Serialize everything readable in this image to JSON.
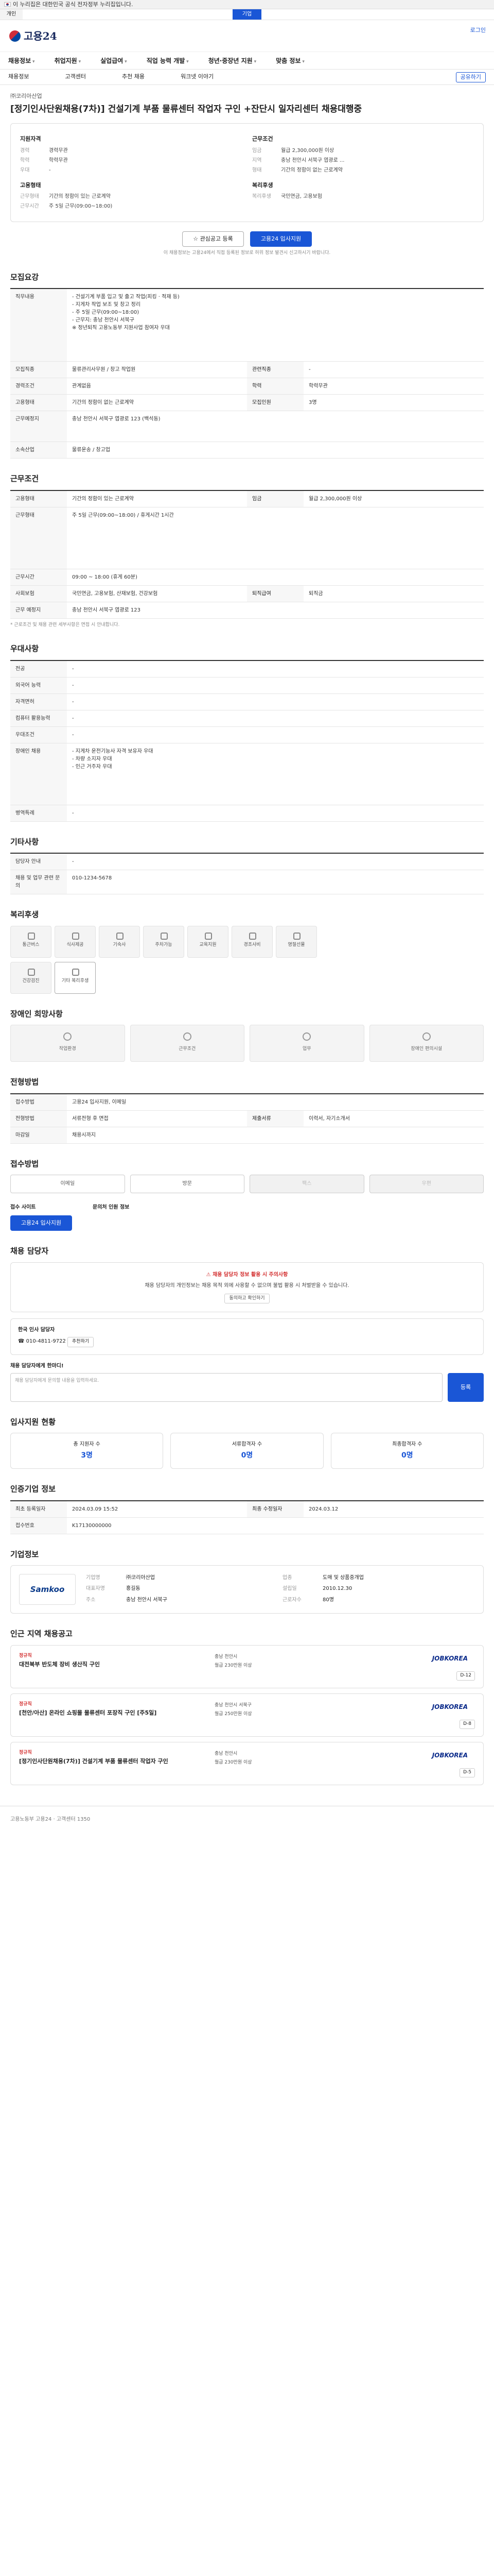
{
  "gov_banner": "이 누리집은 대한민국 공식 전자정부 누리집입니다.",
  "topline": {
    "left": "개인",
    "center": "기업"
  },
  "brand": {
    "logo": "고용24",
    "login": "로그인"
  },
  "menu": [
    "채용정보",
    "취업지원",
    "실업급여",
    "직업 능력 개발",
    "청년·중장년 지원",
    "맞춤 정보"
  ],
  "subnav": [
    "채용정보",
    "고객센터",
    "추천 채용",
    "워크넷 이야기"
  ],
  "share": "공유하기",
  "hero": {
    "agency": "㈜코리아산업",
    "title": "[정기인사단원채용(7차)] 건설기계 부품 물류센터 작업자 구인 +잔단시 일자리센터 채용대행중"
  },
  "info": {
    "col1_title": "지원자격",
    "col1": [
      [
        "경력",
        "경력무관"
      ],
      [
        "학력",
        "학력무관"
      ],
      [
        "우대",
        "-"
      ]
    ],
    "col2_title": "근무조건",
    "col2": [
      [
        "임금",
        "월급 2,300,000원 이상"
      ],
      [
        "지역",
        "충남 천안시 서북구 엽광로 ..."
      ],
      [
        "형태",
        "기간의 정함이 없는 근로계약"
      ]
    ],
    "col3_title": "고용형태",
    "col3": [
      [
        "근무형태",
        "기간의 정함이 있는 근로계약"
      ],
      [
        "근무시간",
        "주 5일 근무(09:00~18:00)"
      ]
    ],
    "col4_title": "복리후생",
    "col4": [
      [
        "복리후생",
        "국민연금, 고용보험"
      ]
    ]
  },
  "buttons": {
    "interest": "관심공고 등록",
    "apply": "고용24 입사지원"
  },
  "notice": "이 채용정보는 고용24에서 직접 등록된 정보로 허위 정보 발견시 신고하시기 바랍니다.",
  "s1": {
    "title": "모집요강",
    "duty_label": "직무내용",
    "duty_text": "- 건설기계 부품 입고 및 출고 작업(피킹 · 적재 등)\n- 지게차 작업 보조 및 창고 정리\n- 주 5일 근무(09:00~18:00)\n- 근무지: 충남 천안시 서북구\n※ 정년퇴직 고용노동부 지원사업 참여자 우대",
    "rows": [
      [
        "모집직종",
        "물류관리사무원 / 창고 작업원"
      ],
      [
        "관련직종",
        "-"
      ],
      [
        "경력조건",
        "관계없음"
      ],
      [
        "학력",
        "학력무관"
      ],
      [
        "고용형태",
        "기간의 정함이 없는 근로계약"
      ],
      [
        "모집인원",
        "3명"
      ],
      [
        "근무예정지",
        "충남 천안시 서북구 엽광로 123 (백석동)"
      ],
      [
        "소속산업",
        "물류운송 / 창고업"
      ]
    ]
  },
  "s2": {
    "title": "근무조건",
    "rows": [
      [
        "고용형태",
        "기간의 정함이 있는 근로계약"
      ],
      [
        "임금",
        "월급 2,300,000원 이상"
      ],
      [
        "근무형태",
        "주 5일 근무"
      ],
      [
        "근무시간",
        "09:00 ~ 18:00 (휴게 60분)"
      ],
      [
        "사회보험",
        "국민연금, 고용보험, 산재보험, 건강보험"
      ],
      [
        "퇴직급여",
        "퇴직금"
      ],
      [
        "근무 예정지",
        "충남 천안시 서북구 엽광로 123"
      ]
    ],
    "worktime_note": "주 5일 근무(09:00~18:00) / 휴게시간 1시간",
    "note": "* 근로조건 및 채용 관련 세부사항은 면접 시 안내합니다."
  },
  "s3": {
    "title": "우대사항",
    "rows": [
      [
        "전공",
        "-"
      ],
      [
        "외국어 능력",
        "-"
      ],
      [
        "자격면허",
        "-"
      ],
      [
        "컴퓨터 활용능력",
        "-"
      ],
      [
        "우대조건",
        "-"
      ],
      [
        "장애인 채용",
        "-"
      ],
      [
        "병역특례",
        "-"
      ]
    ],
    "etc": "- 지게차 운전기능사 자격 보유자 우대\n- 차량 소지자 우대\n- 인근 거주자 우대"
  },
  "s4": {
    "title": "기타사항",
    "rows": [
      [
        "담당자 안내",
        "-"
      ],
      [
        "채용 및 업무 관련 문의",
        "010-1234-5678"
      ]
    ]
  },
  "s5": {
    "title": "복리후생",
    "icons": [
      "통근버스",
      "식사제공",
      "기숙사",
      "주차가능",
      "교육지원",
      "경조사비",
      "명절선물",
      "건강검진"
    ],
    "extra": "기타 복리후생"
  },
  "s6": {
    "title": "장애인 희망사항",
    "cards": [
      "작업환경",
      "근무조건",
      "업무",
      "장애인 편의시설"
    ]
  },
  "s7": {
    "title": "전형방법",
    "rows": [
      [
        "접수방법",
        "고용24 입사지원, 이메일"
      ],
      [
        "전형방법",
        "서류전형 후 면접"
      ],
      [
        "제출서류",
        "이력서, 자기소개서"
      ],
      [
        "마감일",
        "채용시까지"
      ]
    ]
  },
  "s8": {
    "title": "접수방법",
    "tabs": [
      "이메일",
      "방문",
      "팩스",
      "우편"
    ],
    "site_label": "접수 사이트",
    "site_btn": "고용24 입사지원",
    "contact": "문의처 인원 정보"
  },
  "s9": {
    "title": "채용 담당자",
    "warn": "채용 담당자 정보 활용 시 주의사항",
    "warn_text": "채용 담당자의 개인정보는 채용 목적 외에 사용할 수 없으며 불법 활용 시 처벌받을 수 있습니다.",
    "agree": "동의하고 확인하기",
    "name": "한국 인사 담당자",
    "phone": "010-4811-9722",
    "apply_btn": "추천하기",
    "prompt": "채용 담당자에게 한마디!",
    "placeholder": "채용 담당자에게 문의할 내용을 입력하세요.",
    "send": "등록"
  },
  "s10": {
    "title": "입사지원 현황",
    "stats": [
      [
        "총 지원자 수",
        "3명"
      ],
      [
        "서류합격자 수",
        "0명"
      ],
      [
        "최종합격자 수",
        "0명"
      ]
    ]
  },
  "s11": {
    "title": "인증기업 정보",
    "rows": [
      [
        "최초 등록일자",
        "2024.03.09 15:52"
      ],
      [
        "최종 수정일자",
        "2024.03.12"
      ],
      [
        "접수번호",
        "K17130000000"
      ]
    ]
  },
  "s12": {
    "title": "기업정보",
    "logo": "Samkoo",
    "grid": [
      [
        "기업명",
        "㈜코리아산업"
      ],
      [
        "업종",
        "도매 및 상품중개업"
      ],
      [
        "대표자명",
        "홍길동"
      ],
      [
        "설립일",
        "2010.12.30"
      ],
      [
        "주소",
        "충남 천안시 서북구"
      ],
      [
        "근로자수",
        "80명"
      ],
      [
        "매출액",
        "-"
      ],
      [
        "홈페이지",
        "-"
      ]
    ]
  },
  "s13": {
    "title": "인근 지역 채용공고",
    "cards": [
      {
        "tag": "정규직",
        "t": "대전북부 반도체 장비 생산직 구인",
        "m1": "충남 천안시",
        "m2": "월급 230만원 이상",
        "logo": "JOBKOREA",
        "d": "D-12"
      },
      {
        "tag": "정규직",
        "t": "[천안/아산] 온라인 쇼핑몰 물류센터 포장직 구인 [주5일]",
        "m1": "충남 천안시 서북구",
        "m2": "월급 250만원 이상",
        "logo": "JOBKOREA",
        "d": "D-8"
      },
      {
        "tag": "정규직",
        "t": "[정기인사단원채용(7차)] 건설기계 부품 물류센터 작업자 구인",
        "m1": "충남 천안시",
        "m2": "월급 230만원 이상",
        "logo": "JOBKOREA",
        "d": "D-5"
      }
    ]
  },
  "footer": "고용노동부 고용24 · 고객센터 1350"
}
